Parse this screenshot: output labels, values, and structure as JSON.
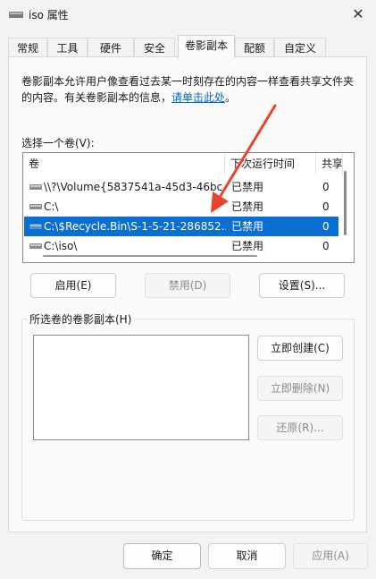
{
  "window": {
    "title": "iso 属性",
    "close_glyph": "✕"
  },
  "tabs": [
    {
      "label": "常规"
    },
    {
      "label": "工具"
    },
    {
      "label": "硬件"
    },
    {
      "label": "安全"
    },
    {
      "label": "卷影副本",
      "active": true
    },
    {
      "label": "配额"
    },
    {
      "label": "自定义"
    }
  ],
  "description": {
    "line1": "卷影副本允许用户像查看过去某一时刻存在的内容一样查看共享文件夹",
    "line2_prefix": "的内容。有关卷影副本的信息，",
    "link": "请单击此处",
    "line2_suffix": "。"
  },
  "volume_section": {
    "label": "选择一个卷(V):",
    "columns": [
      "卷",
      "下次运行时间",
      "共享"
    ],
    "rows": [
      {
        "volume": "\\\\?\\Volume{5837541a-45d3-46bc...",
        "next_run": "已禁用",
        "shares": "0"
      },
      {
        "volume": "C:\\",
        "next_run": "已禁用",
        "shares": "0"
      },
      {
        "volume": "C:\\$Recycle.Bin\\S-1-5-21-286852...",
        "next_run": "已禁用",
        "shares": "0",
        "selected": true
      },
      {
        "volume": "C:\\iso\\",
        "next_run": "已禁用",
        "shares": "0"
      }
    ]
  },
  "volume_buttons": {
    "enable": "启用(E)",
    "disable": "禁用(D)",
    "settings": "设置(S)..."
  },
  "copies_group": {
    "label": "所选卷的卷影副本(H)",
    "create_now": "立即创建(C)",
    "delete_now": "立即删除(N)",
    "restore": "还原(R)..."
  },
  "dialog_buttons": {
    "ok": "确定",
    "cancel": "取消",
    "apply": "应用(A)"
  },
  "colors": {
    "selection": "#0b6ed1",
    "link": "#0066cc",
    "arrow": "#e8432b"
  }
}
